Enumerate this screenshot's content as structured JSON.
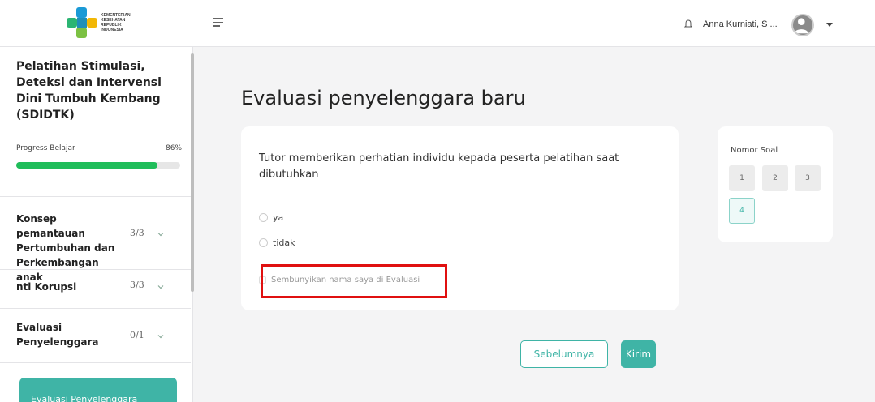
{
  "header": {
    "logo_text": [
      "KEMENTERIAN",
      "KESEHATAN",
      "REPUBLIK",
      "INDONESIA"
    ],
    "user_name": "Anna Kurniati, S ...",
    "icons": [
      "menu-icon",
      "bell-icon",
      "avatar",
      "caret-down-icon"
    ]
  },
  "sidebar": {
    "course_title": "Pelatihan Stimulasi, Deteksi dan Intervensi Dini Tumbuh Kembang (SDIDTK)",
    "progress_label": "Progress Belajar",
    "progress_text": "86%",
    "progress_value": 0.86,
    "modules": [
      {
        "name": "Konsep pemantauan Pertumbuhan dan Perkembangan anak",
        "count": "3/3"
      },
      {
        "name": "nti Korupsi",
        "count": "3/3"
      },
      {
        "name": "Evaluasi Penyelenggara",
        "count": "0/1"
      }
    ],
    "active_button": "Evaluasi Penyelenggara"
  },
  "main": {
    "page_title": "Evaluasi penyelenggara baru",
    "question": "Tutor memberikan perhatian individu kepada peserta pelatihan saat dibutuhkan",
    "options": [
      "ya",
      "tidak"
    ],
    "anonymous_label": "Sembunyikan nama saya di Evaluasi",
    "nav_title": "Nomor Soal",
    "question_numbers": [
      "1",
      "2",
      "3",
      "4"
    ],
    "current_question": "4",
    "prev_label": "Sebelumnya",
    "submit_label": "Kirim"
  },
  "colors": {
    "accent": "#3fb4a6",
    "progress": "#1fbd5a",
    "highlight": "#e01010"
  }
}
